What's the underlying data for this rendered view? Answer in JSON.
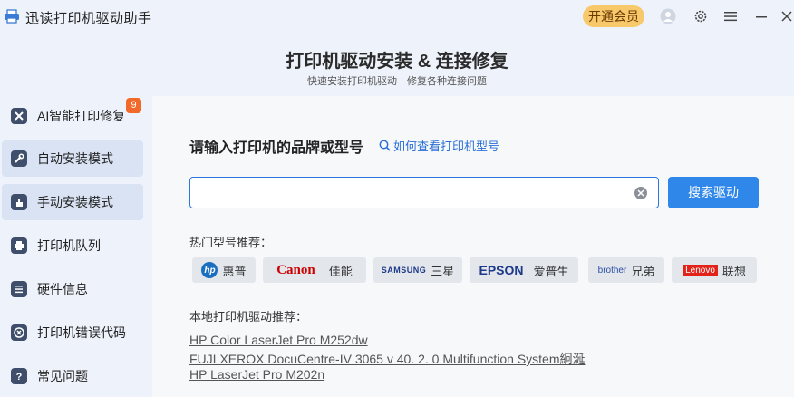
{
  "app": {
    "title": "迅读打印机驱动助手",
    "vip_label": "开通会员"
  },
  "colors": {
    "accent": "#2e87e9",
    "vip": "#f7c96b",
    "badge": "#f26a2a",
    "hp": "#1a6fc0",
    "canon": "#cc0000",
    "epson": "#1d3a8a",
    "lenovo": "#e2231a",
    "brother": "#2a4fa8"
  },
  "banner": {
    "title": "打印机驱动安装 & 连接修复",
    "subtitle": "快速安装打印机驱动  修复各种连接问题"
  },
  "sidebar": {
    "items": [
      {
        "label": "AI智能打印修复",
        "icon": "tools-icon",
        "badge": "9"
      },
      {
        "label": "自动安装模式",
        "icon": "wrench-icon"
      },
      {
        "label": "手动安装模式",
        "icon": "hand-icon"
      },
      {
        "label": "打印机队列",
        "icon": "printer-icon"
      },
      {
        "label": "硬件信息",
        "icon": "list-icon"
      },
      {
        "label": "打印机错误代码",
        "icon": "error-icon"
      },
      {
        "label": "常见问题",
        "icon": "question-icon"
      }
    ]
  },
  "main": {
    "heading": "请输入打印机的品牌或型号",
    "help_link": "如何查看打印机型号",
    "search_value": "",
    "search_button": "搜索驱动",
    "hot_label": "热门型号推荐：",
    "brands": [
      {
        "logo": "hp",
        "name": "惠普"
      },
      {
        "logo": "Canon",
        "name": "佳能"
      },
      {
        "logo": "SAMSUNG",
        "name": "三星"
      },
      {
        "logo": "EPSON",
        "name": "爱普生"
      },
      {
        "logo": "brother",
        "name": "兄弟"
      },
      {
        "logo": "Lenovo",
        "name": "联想"
      }
    ],
    "local_label": "本地打印机驱动推荐：",
    "drivers": [
      "HP Color LaserJet Pro M252dw",
      "FUJI XEROX DocuCentre-IV 3065  v 40.  2.  0 Multifunction System絅涎",
      "HP LaserJet Pro M202n"
    ]
  }
}
